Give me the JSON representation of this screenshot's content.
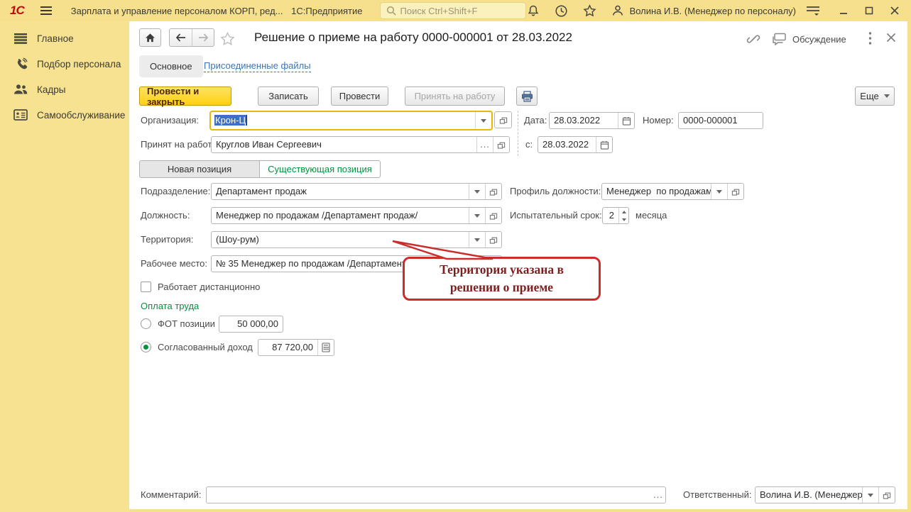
{
  "titlebar": {
    "logo": "1С",
    "app_title": "Зарплата и управление персоналом КОРП, ред...",
    "platform": "1С:Предприятие",
    "search_placeholder": "Поиск Ctrl+Shift+F",
    "user": "Волина И.В. (Менеджер по персоналу)"
  },
  "sidebar": {
    "items": [
      {
        "label": "Главное"
      },
      {
        "label": "Подбор персонала"
      },
      {
        "label": "Кадры"
      },
      {
        "label": "Самообслуживание"
      }
    ]
  },
  "doc": {
    "title": "Решение о приеме на работу 0000-000001 от 28.03.2022",
    "discussion": "Обсуждение",
    "tabs": {
      "main": "Основное",
      "files": "Присоединенные файлы"
    },
    "toolbar": {
      "post_close": "Провести и закрыть",
      "save": "Записать",
      "post": "Провести",
      "hire": "Принять на работу",
      "more": "Еще"
    }
  },
  "ui": {
    "ellipsis": "..."
  },
  "form": {
    "organization": {
      "label": "Организация:",
      "value": "Крон-Ц"
    },
    "date": {
      "label": "Дата:",
      "value": "28.03.2022"
    },
    "number": {
      "label": "Номер:",
      "value": "0000-000001"
    },
    "employee": {
      "label": "Принят на работу:",
      "value": "Круглов Иван Сергеевич"
    },
    "from_date": {
      "label": "с:",
      "value": "28.03.2022"
    },
    "toggle": {
      "new": "Новая позиция",
      "existing": "Существующая позиция",
      "active": "existing"
    },
    "department": {
      "label": "Подразделение:",
      "value": "Департамент продаж"
    },
    "profile": {
      "label": "Профиль должности:",
      "value": "Менеджер  по продажам"
    },
    "position": {
      "label": "Должность:",
      "value": "Менеджер по продажам /Департамент продаж/"
    },
    "probation": {
      "label": "Испытательный срок:",
      "value": "2",
      "suffix": "месяца"
    },
    "territory": {
      "label": "Территория:",
      "value": "(Шоу-рум)"
    },
    "workplace": {
      "label": "Рабочее место:",
      "value": "№ 35 Менеджер по продажам /Департамент"
    },
    "remote": {
      "label": "Работает дистанционно",
      "checked": false
    },
    "payment": {
      "title": "Оплата труда",
      "fot": {
        "label": "ФОТ позиции",
        "value": "50 000,00",
        "checked": false
      },
      "agreed": {
        "label": "Согласованный доход",
        "value": "87 720,00",
        "checked": true
      }
    },
    "comment": {
      "label": "Комментарий:",
      "value": ""
    },
    "responsible": {
      "label": "Ответственный:",
      "value": "Волина И.В. (Менеджер п"
    }
  },
  "callout": {
    "text": "Территория указана в решении о приеме"
  },
  "colors": {
    "accent_yellow": "#f6e08e",
    "button_yellow": "#ffd012",
    "green": "#00923f",
    "link_blue": "#3e74b4",
    "callout_red": "#cb2c2c",
    "callout_text": "#7d1f1f",
    "selection_blue": "#3f6fc1",
    "focus_gold": "#e9b800"
  }
}
